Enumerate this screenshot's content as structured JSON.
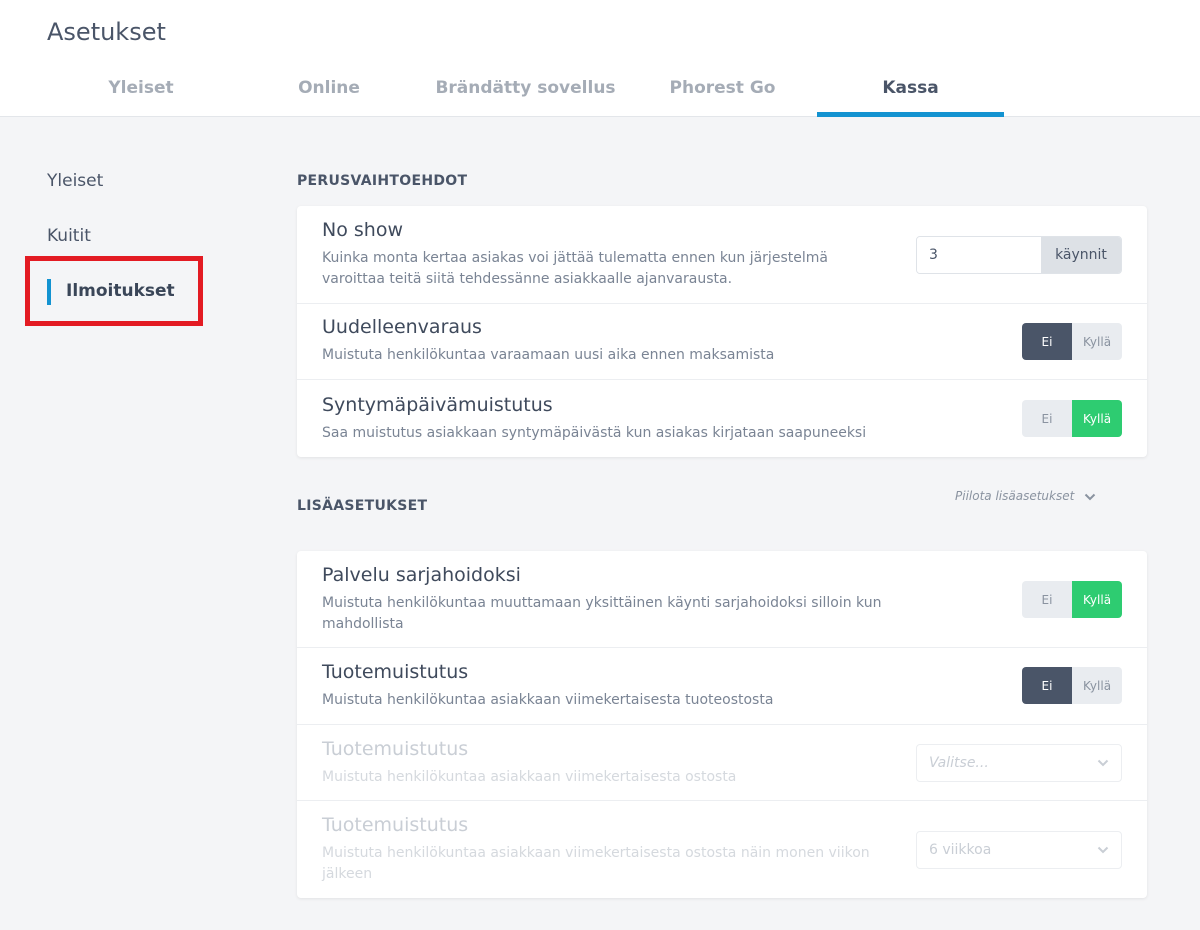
{
  "header": {
    "title": "Asetukset",
    "tabs": [
      {
        "label": "Yleiset"
      },
      {
        "label": "Online"
      },
      {
        "label": "Brändätty sovellus"
      },
      {
        "label": "Phorest Go"
      },
      {
        "label": "Kassa"
      }
    ],
    "active_tab": "Kassa"
  },
  "sidebar": {
    "items": [
      {
        "label": "Yleiset"
      },
      {
        "label": "Kuitit"
      },
      {
        "label": "Ilmoitukset"
      }
    ],
    "active_item": "Ilmoitukset"
  },
  "basic": {
    "title": "PERUSVAIHTOEHDOT",
    "no_show": {
      "title": "No show",
      "desc": "Kuinka monta kertaa asiakas voi jättää tulematta ennen kun järjestelmä varoittaa teitä siitä tehdessänne asiakkaalle ajanvarausta.",
      "value": "3",
      "unit": "käynnit"
    },
    "rebooking": {
      "title": "Uudelleenvaraus",
      "desc": "Muistuta henkilökuntaa varaamaan uusi aika ennen maksamista",
      "off": "Ei",
      "on": "Kyllä",
      "selected": "Ei"
    },
    "birthday": {
      "title": "Syntymäpäivämuistutus",
      "desc": "Saa muistutus asiakkaan syntymäpäivästä kun asiakas kirjataan saapuneeksi",
      "off": "Ei",
      "on": "Kyllä",
      "selected": "Kyllä"
    }
  },
  "advanced": {
    "title": "LISÄASETUKSET",
    "hide_label": "Piilota lisäasetukset",
    "course": {
      "title": "Palvelu sarjahoidoksi",
      "desc": "Muistuta henkilökuntaa muuttamaan yksittäinen käynti sarjahoidoksi silloin kun mahdollista",
      "off": "Ei",
      "on": "Kyllä",
      "selected": "Kyllä"
    },
    "product_reminder": {
      "title": "Tuotemuistutus",
      "desc": "Muistuta henkilökuntaa asiakkaan viimekertaisesta tuoteostosta",
      "off": "Ei",
      "on": "Kyllä",
      "selected": "Ei"
    },
    "product_select": {
      "title": "Tuotemuistutus",
      "desc": "Muistuta henkilökuntaa asiakkaan viimekertaisesta ostosta",
      "placeholder": "Valitse..."
    },
    "product_weeks": {
      "title": "Tuotemuistutus",
      "desc": "Muistuta henkilökuntaa asiakkaan viimekertaisesta ostosta näin monen viikon jälkeen",
      "value": "6 viikkoa"
    }
  },
  "colors": {
    "accent": "#1393d1",
    "toggle_off_selected": "#4a5568",
    "toggle_on_selected": "#2ecc71",
    "highlight": "#e31b23"
  }
}
